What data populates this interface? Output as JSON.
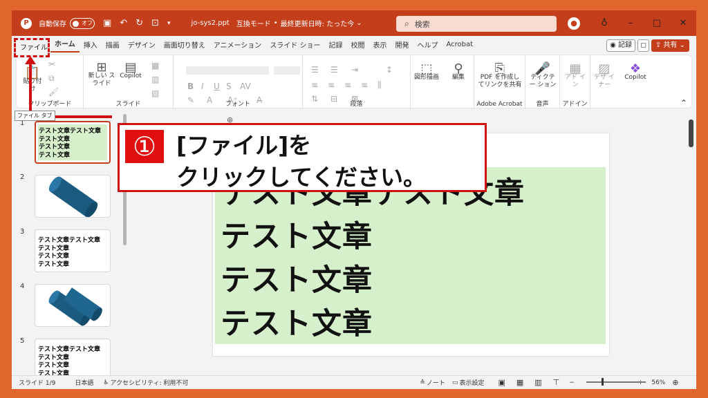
{
  "titlebar": {
    "app_logo": "P",
    "autosave_label": "自動保存",
    "toggle_state": "オフ",
    "filename": "jo-sys2.ppt",
    "mode": "互換モード",
    "modified": "最終更新日時: たった今",
    "search_placeholder": "検索"
  },
  "tabs": [
    "ファイル",
    "ホーム",
    "挿入",
    "描画",
    "デザイン",
    "画面切り替え",
    "アニメーション",
    "スライド ショー",
    "記録",
    "校閲",
    "表示",
    "開発",
    "ヘルプ",
    "Acrobat"
  ],
  "ribbon_right": {
    "record": "記録",
    "share": "共有"
  },
  "ribbon": {
    "paste": "貼り付け",
    "new_slide": "新しい スライド",
    "copilot": "Copilot",
    "shape_draw": "図形描画",
    "edit": "編集",
    "pdf_create": "PDF を作成し てリンクを共有",
    "dictate": "ディクテー ション",
    "addin": "アド イン",
    "designer": "デザ イナー",
    "copilot2": "Copilot",
    "groups": {
      "clipboard": "クリップボード",
      "slides": "スライド",
      "font": "フォント",
      "paragraph": "段落",
      "adobe": "Adobe Acrobat",
      "voice": "音声",
      "addins": "アドイン"
    }
  },
  "tooltip": "ファイル タブ",
  "thumbs": [
    {
      "num": "1",
      "text": [
        "テスト文章テスト文章",
        "テスト文章",
        "テスト文章",
        "テスト文章"
      ]
    },
    {
      "num": "2"
    },
    {
      "num": "3",
      "text": [
        "テスト文章テスト文章",
        "テスト文章",
        "テスト文章",
        "テスト文章"
      ]
    },
    {
      "num": "4"
    },
    {
      "num": "5",
      "text": [
        "テスト文章テスト文章",
        "テスト文章",
        "テスト文章",
        "テスト文章"
      ]
    }
  ],
  "slide": {
    "lines": [
      "テスト文章テスト文章",
      "テスト文章",
      "テスト文章",
      "テスト文章"
    ]
  },
  "callout": {
    "number": "①",
    "line1": "[ファイル]を",
    "line2": "クリックしてください。"
  },
  "status": {
    "slide": "スライド 1/9",
    "lang": "日本語",
    "accessibility": "アクセシビリティ: 利用不可",
    "notes": "ノート",
    "view_settings": "表示設定",
    "zoom": "56%"
  }
}
